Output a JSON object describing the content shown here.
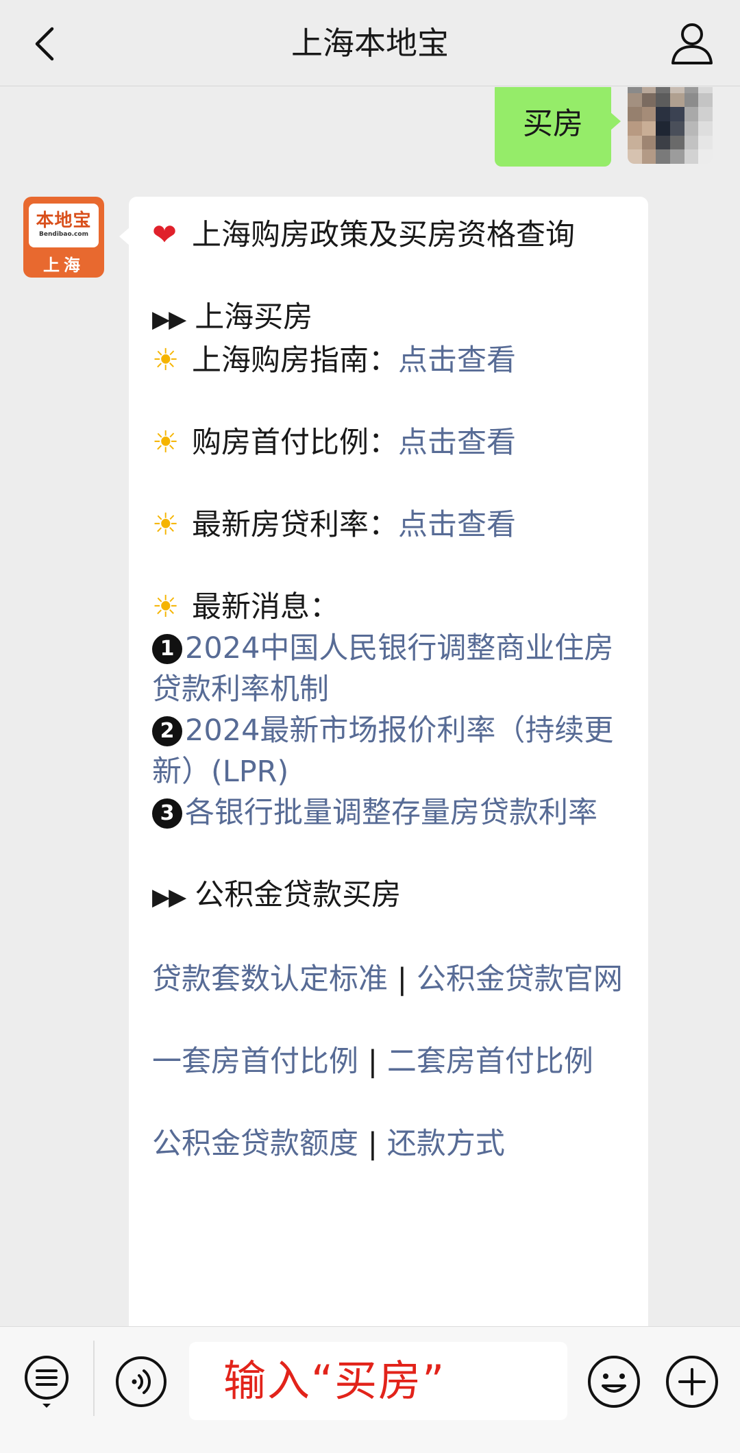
{
  "header": {
    "title": "上海本地宝",
    "back_icon": "chevron-left-icon",
    "profile_icon": "user-icon"
  },
  "conversation": {
    "user_message": "买房",
    "bot_avatar": {
      "brand": "本地宝",
      "domain": "Bendibao.com",
      "city": "上海",
      "color": "#e8692f"
    },
    "bot_message": {
      "title": "上海购房政策及买房资格查询",
      "section1_heading": "上海买房",
      "guide_label": "上海购房指南",
      "downpay_label": "购房首付比例",
      "rate_label": "最新房贷利率",
      "view_link": "点击查看",
      "colon": "：",
      "news_label": "最新消息：",
      "news": [
        {
          "num": "1",
          "text": "2024中国人民银行调整商业住房贷款利率机制"
        },
        {
          "num": "2",
          "text": "2024最新市场报价利率（持续更新）(LPR)"
        },
        {
          "num": "3",
          "text": "各银行批量调整存量房贷款利率"
        }
      ],
      "section2_heading": "公积金贷款买房",
      "link_rows": [
        {
          "a": "贷款套数认定标准",
          "b": "公积金贷款官网"
        },
        {
          "a": "一套房首付比例",
          "b": "二套房首付比例"
        },
        {
          "a": "公积金贷款额度",
          "b": "还款方式"
        }
      ],
      "separator": "|"
    }
  },
  "bottom_bar": {
    "input_value": "输入“买房”",
    "menu_icon": "menu-list-icon",
    "voice_icon": "voice-icon",
    "emoji_icon": "emoji-icon",
    "plus_icon": "plus-icon"
  },
  "colors": {
    "link": "#576b95",
    "self_bubble": "#95ec69",
    "input_text": "#e2231a"
  }
}
